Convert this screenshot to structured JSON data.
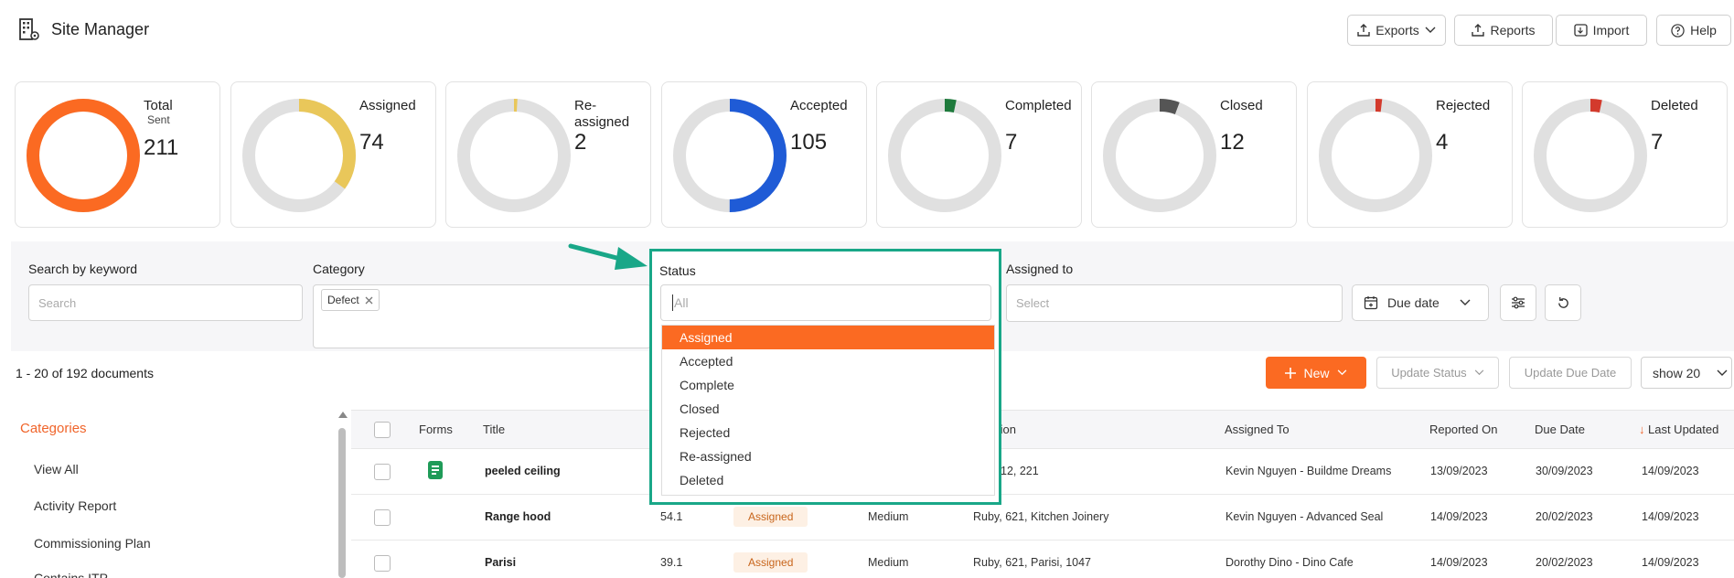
{
  "app": {
    "title": "Site Manager"
  },
  "toolbar": {
    "exports": "Exports",
    "reports": "Reports",
    "import": "Import",
    "help": "Help"
  },
  "stats": [
    {
      "label": "Total",
      "sub": "Sent",
      "value": "211",
      "fraction": 1.0,
      "color": "#fb6a22"
    },
    {
      "label": "Assigned",
      "value": "74",
      "fraction": 0.35,
      "color": "#e9c75a"
    },
    {
      "label": "Re-assigned",
      "value": "2",
      "fraction": 0.01,
      "color": "#e9c75a"
    },
    {
      "label": "Accepted",
      "value": "105",
      "fraction": 0.5,
      "color": "#1f5bd6"
    },
    {
      "label": "Completed",
      "value": "7",
      "fraction": 0.033,
      "color": "#1e7a3c"
    },
    {
      "label": "Closed",
      "value": "12",
      "fraction": 0.057,
      "color": "#555555"
    },
    {
      "label": "Rejected",
      "value": "4",
      "fraction": 0.019,
      "color": "#d33a2c"
    },
    {
      "label": "Deleted",
      "value": "7",
      "fraction": 0.033,
      "color": "#d33a2c"
    }
  ],
  "filters": {
    "keyword_label": "Search by keyword",
    "keyword_placeholder": "Search",
    "category_label": "Category",
    "category_chip": "Defect",
    "status_label": "Status",
    "status_placeholder": "All",
    "assigned_label": "Assigned to",
    "assigned_placeholder": "Select",
    "due_date": "Due date"
  },
  "status_options": [
    "Assigned",
    "Accepted",
    "Complete",
    "Closed",
    "Rejected",
    "Re-assigned",
    "Deleted"
  ],
  "status_selected": "Assigned",
  "list": {
    "count_text": "1 - 20 of 192 documents",
    "new": "New",
    "update_status": "Update Status",
    "update_due": "Update Due Date",
    "show": "show 20"
  },
  "sidebar": {
    "title": "Categories",
    "items": [
      "View All",
      "Activity Report",
      "Commissioning Plan",
      "Contains ITP"
    ]
  },
  "table": {
    "headers": {
      "forms": "Forms",
      "title": "Title",
      "location": "tion",
      "assigned": "Assigned To",
      "reported": "Reported On",
      "due": "Due Date",
      "updated": "Last Updated",
      "updated_arrow": "↓"
    },
    "rows": [
      {
        "title": "peeled ceiling",
        "ref": "",
        "status": "",
        "priority": "",
        "location": "12, 221",
        "assigned": "Kevin Nguyen - Buildme Dreams",
        "reported": "13/09/2023",
        "due": "30/09/2023",
        "updated": "14/09/2023"
      },
      {
        "title": "Range hood",
        "ref": "54.1",
        "status": "Assigned",
        "priority": "Medium",
        "location": "Ruby, 621, Kitchen Joinery",
        "assigned": "Kevin Nguyen - Advanced Seal",
        "reported": "14/09/2023",
        "due": "20/02/2023",
        "updated": "14/09/2023"
      },
      {
        "title": "Parisi",
        "ref": "39.1",
        "status": "Assigned",
        "priority": "Medium",
        "location": "Ruby, 621, Parisi, 1047",
        "assigned": "Dorothy Dino - Dino Cafe",
        "reported": "14/09/2023",
        "due": "20/02/2023",
        "updated": "14/09/2023"
      }
    ]
  },
  "colors": {
    "accent": "#fb6a22",
    "highlight": "#19a788",
    "track": "#e0e0e0"
  }
}
